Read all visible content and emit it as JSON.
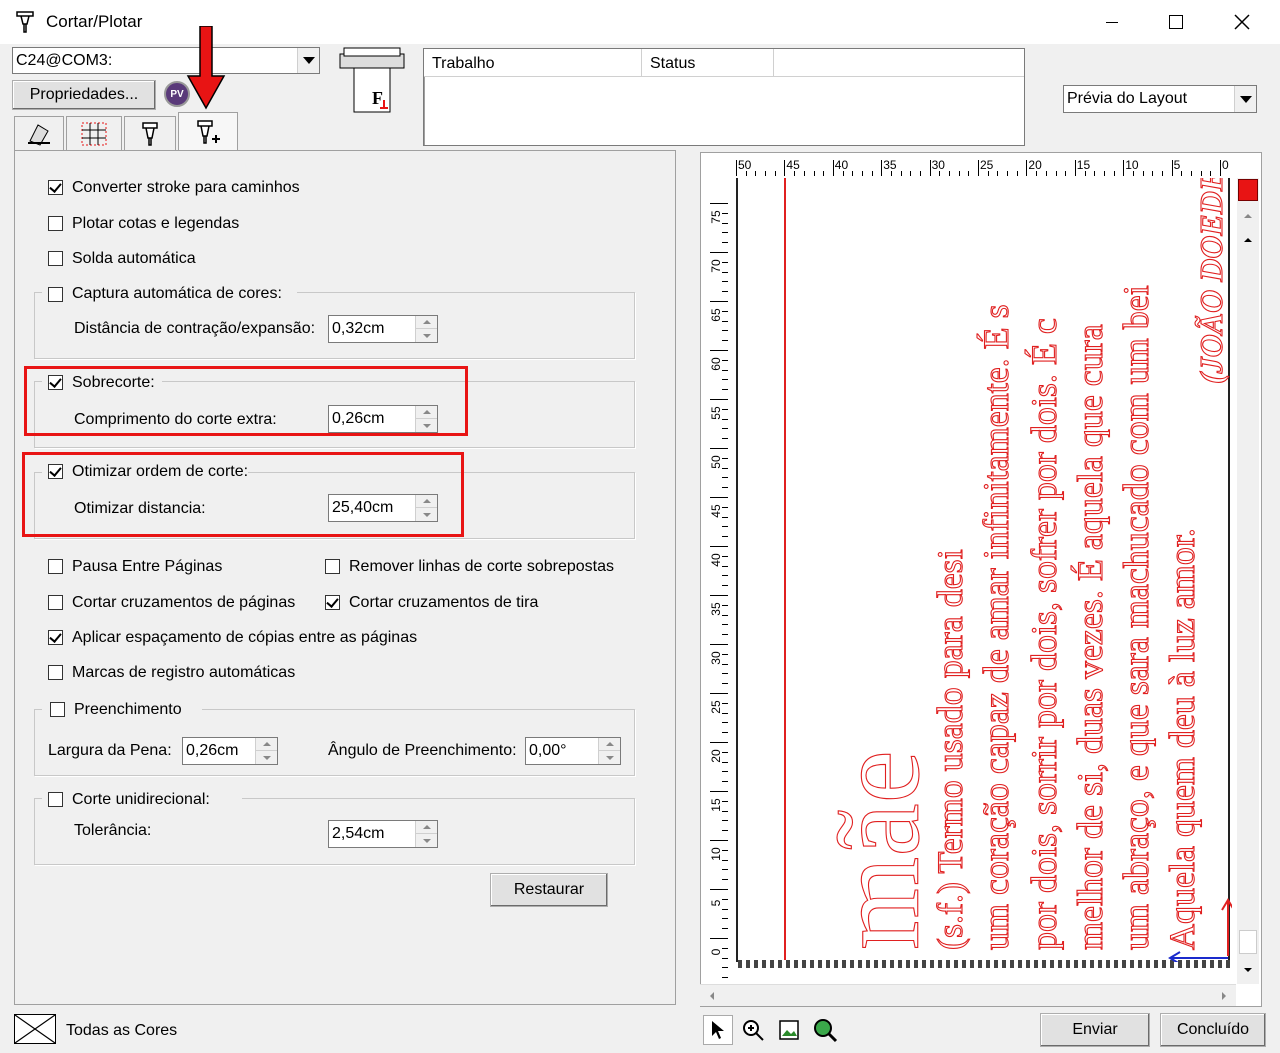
{
  "window": {
    "title": "Cortar/Plotar"
  },
  "device": {
    "selected": "C24@COM3:",
    "properties_label": "Propriedades...",
    "pv_label": "PV"
  },
  "job_table": {
    "columns": [
      "Trabalho",
      "Status"
    ]
  },
  "preview_mode": {
    "selected": "Prévia do Layout"
  },
  "options": {
    "convert_stroke": {
      "label": "Converter stroke para caminhos",
      "checked": true
    },
    "plot_dims": {
      "label": "Plotar cotas e legendas",
      "checked": false
    },
    "auto_weld": {
      "label": "Solda automática",
      "checked": false
    },
    "auto_color": {
      "label": "Captura automática de cores:",
      "checked": false,
      "field_label": "Distância de contração/expansão:",
      "value": "0,32cm"
    },
    "overcut": {
      "label": "Sobrecorte:",
      "checked": true,
      "field_label": "Comprimento do corte extra:",
      "value": "0,26cm"
    },
    "optimize": {
      "label": "Otimizar ordem de corte:",
      "checked": true,
      "field_label": "Otimizar distancia:",
      "value": "25,40cm"
    },
    "pause_pages": {
      "label": "Pausa Entre Páginas",
      "checked": false
    },
    "remove_overlap": {
      "label": "Remover linhas de corte sobrepostas",
      "checked": false
    },
    "cut_page_cross": {
      "label": "Cortar cruzamentos de páginas",
      "checked": false
    },
    "cut_strip_cross": {
      "label": "Cortar cruzamentos de tira",
      "checked": true
    },
    "copy_spacing": {
      "label": "Aplicar espaçamento de cópias entre as páginas",
      "checked": true
    },
    "reg_marks": {
      "label": "Marcas de registro automáticas",
      "checked": false
    },
    "fill": {
      "label": "Preenchimento",
      "checked": false,
      "pen_label": "Largura da Pena:",
      "pen_value": "0,26cm",
      "angle_label": "Ângulo de Preenchimento:",
      "angle_value": "0,00°"
    },
    "unidirectional": {
      "label": "Corte unidirecional:",
      "checked": false,
      "field_label": "Tolerância:",
      "value": "2,54cm"
    }
  },
  "restore_label": "Restaurar",
  "ruler": {
    "top": [
      "50",
      "45",
      "40",
      "35",
      "30",
      "25",
      "20",
      "15",
      "10",
      "5",
      "0"
    ],
    "left": [
      "75",
      "70",
      "65",
      "60",
      "55",
      "50",
      "45",
      "40",
      "35",
      "30",
      "25",
      "20",
      "15",
      "10",
      "5",
      "0"
    ]
  },
  "preview_text": {
    "big_word": "mãe",
    "lines": [
      "(s.f.) Termo usado para desi",
      "um coração capaz de amar infinitamente. É s",
      "por dois, sorrir por dois, sofrer por dois. É c",
      "melhor de si, duas vezes. É aquela que cura",
      "um abraço, e que sara machucado com um bei",
      "Aquela quem deu à luz amor."
    ],
    "author": "(JOÃO DOEDE"
  },
  "status": {
    "colors_label": "Todas as Cores"
  },
  "footer": {
    "send_label": "Enviar",
    "done_label": "Concluído"
  },
  "colors": {
    "accent_red": "#e81414",
    "preview_red": "#e02020"
  }
}
